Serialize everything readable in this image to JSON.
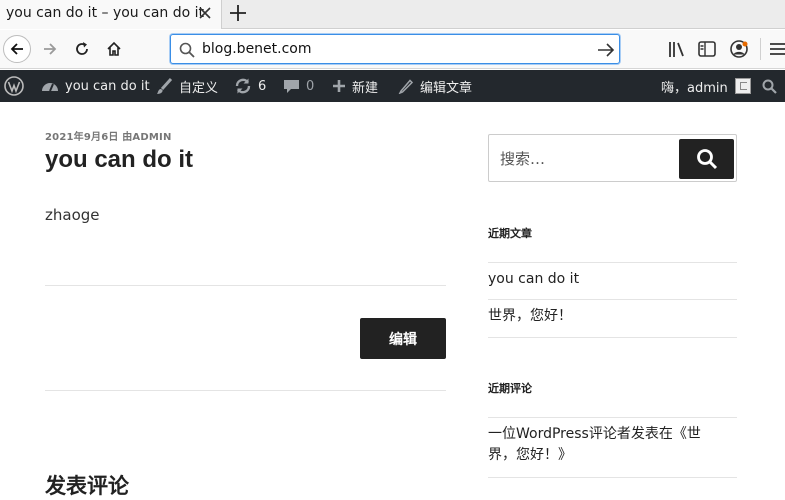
{
  "browser": {
    "tab_title": "you can do it – you can do it",
    "url": "blog.benet.com"
  },
  "adminbar": {
    "site_name": "you can do it",
    "customize": "自定义",
    "updates_count": "6",
    "comments_count": "0",
    "new": "新建",
    "edit_post": "编辑文章",
    "greeting": "嗨，admin"
  },
  "post": {
    "meta": "2021年9月6日 由ADMIN",
    "title": "you can do it",
    "body": "zhaoge",
    "edit_label": "编辑",
    "comment_heading": "发表评论"
  },
  "sidebar": {
    "search_placeholder": "搜索…",
    "recent_posts_title": "近期文章",
    "recent_posts": [
      "you can do it",
      "世界，您好！"
    ],
    "recent_comments_title": "近期评论",
    "recent_comment": "一位WordPress评论者发表在《世界，您好！》"
  },
  "colors": {
    "adminbar_bg": "#23282d",
    "button_bg": "#222222",
    "url_focus": "#3a8ee6"
  }
}
